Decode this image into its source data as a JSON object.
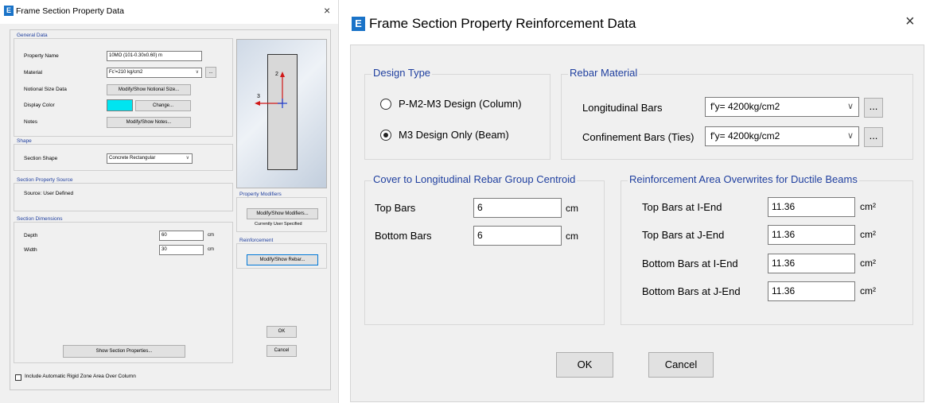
{
  "left_dialog": {
    "title": "Frame Section Property Data",
    "app_icon_letter": "E",
    "close_glyph": "×",
    "general_data": {
      "label": "General Data",
      "property_name_label": "Property Name",
      "property_name_value": "10MO (101-0.30x0.60) m",
      "material_label": "Material",
      "material_value": "Fc'=210 kg/cm2",
      "material_more": "...",
      "notional_label": "Notional Size Data",
      "notional_button": "Modify/Show Notional Size...",
      "display_color_label": "Display Color",
      "display_color_value": "#00e5f0",
      "change_button": "Change...",
      "notes_label": "Notes",
      "notes_button": "Modify/Show Notes..."
    },
    "shape": {
      "label": "Shape",
      "section_shape_label": "Section Shape",
      "section_shape_value": "Concrete Rectangular"
    },
    "section_property_source": {
      "label": "Section Property Source",
      "source_text": "Source:  User Defined"
    },
    "section_dimensions": {
      "label": "Section Dimensions",
      "depth_label": "Depth",
      "depth_value": "60",
      "depth_unit": "cm",
      "width_label": "Width",
      "width_value": "30",
      "width_unit": "cm"
    },
    "preview": {
      "axis_2": "2",
      "axis_3": "3"
    },
    "property_modifiers": {
      "label": "Property Modifiers",
      "button": "Modify/Show Modifiers...",
      "status": "Currently User Specified"
    },
    "reinforcement": {
      "label": "Reinforcement",
      "button": "Modify/Show Rebar..."
    },
    "show_section_properties_button": "Show Section Properties...",
    "ok_button": "OK",
    "cancel_button": "Cancel",
    "rigid_zone_checkbox_label": "Include Automatic Rigid Zone Area Over Column"
  },
  "right_dialog": {
    "title": "Frame Section Property Reinforcement Data",
    "app_icon_letter": "E",
    "close_glyph": "×",
    "design_type": {
      "label": "Design Type",
      "option_column": "P-M2-M3 Design  (Column)",
      "option_beam": "M3 Design Only  (Beam)",
      "selected": "beam"
    },
    "rebar_material": {
      "label": "Rebar Material",
      "longitudinal_label": "Longitudinal Bars",
      "longitudinal_value": "f'y= 4200kg/cm2",
      "confinement_label": "Confinement Bars (Ties)",
      "confinement_value": "f'y= 4200kg/cm2",
      "more": "..."
    },
    "cover": {
      "label": "Cover to Longitudinal Rebar Group Centroid",
      "top_label": "Top Bars",
      "top_value": "6",
      "bottom_label": "Bottom  Bars",
      "bottom_value": "6",
      "unit": "cm"
    },
    "overwrites": {
      "label": "Reinforcement Area Overwrites for Ductile Beams",
      "unit": "cm²",
      "rows": [
        {
          "label": "Top Bars at I-End",
          "value": "11.36"
        },
        {
          "label": "Top Bars at J-End",
          "value": "11.36"
        },
        {
          "label": "Bottom Bars at I-End",
          "value": "11.36"
        },
        {
          "label": "Bottom Bars at J-End",
          "value": "11.36"
        }
      ]
    },
    "ok_button": "OK",
    "cancel_button": "Cancel"
  }
}
